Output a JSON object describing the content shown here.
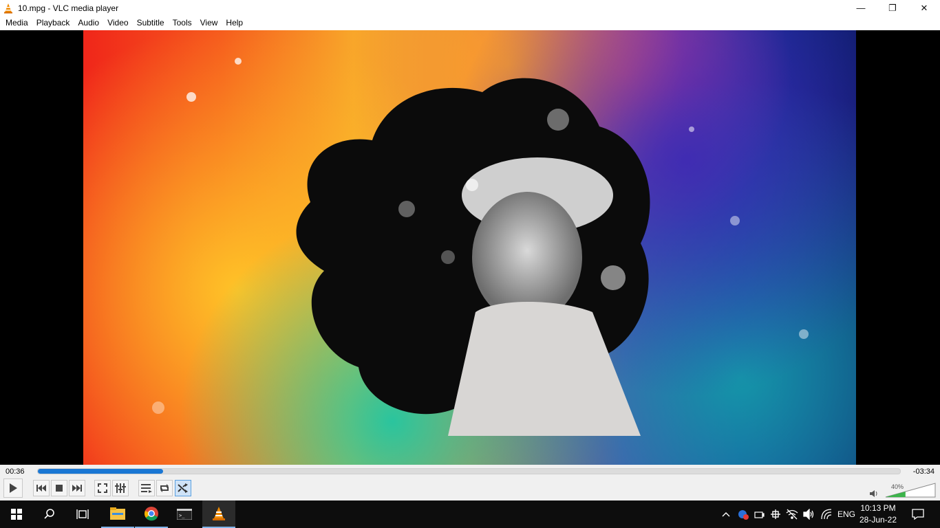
{
  "window": {
    "title": "10.mpg - VLC media player",
    "minimize_glyph": "—",
    "maximize_glyph": "❐",
    "close_glyph": "✕"
  },
  "menu": {
    "items": [
      "Media",
      "Playback",
      "Audio",
      "Video",
      "Subtitle",
      "Tools",
      "View",
      "Help"
    ]
  },
  "player": {
    "time_elapsed": "00:36",
    "time_remaining": "-03:34",
    "seek_progress": 0.145,
    "volume_label": "40%",
    "volume_level": 0.4,
    "random_active": true,
    "colors": {
      "accent": "#1a77d4",
      "volume_fill": "#3cb44b"
    }
  },
  "controls": [
    {
      "name": "play-button",
      "icon": "play-icon"
    },
    {
      "name": "previous-button",
      "icon": "skip-previous-icon"
    },
    {
      "name": "stop-button",
      "icon": "stop-icon"
    },
    {
      "name": "next-button",
      "icon": "skip-next-icon"
    },
    {
      "name": "fullscreen-button",
      "icon": "fullscreen-icon"
    },
    {
      "name": "extended-settings-button",
      "icon": "equalizer-icon"
    },
    {
      "name": "playlist-button",
      "icon": "playlist-icon"
    },
    {
      "name": "loop-button",
      "icon": "loop-icon"
    },
    {
      "name": "random-button",
      "icon": "shuffle-icon"
    }
  ],
  "taskbar": {
    "apps": [
      "start-icon",
      "search-icon",
      "task-view-icon",
      "file-explorer-icon",
      "chrome-icon",
      "terminal-icon",
      "vlc-icon"
    ],
    "tray": {
      "language": "ENG",
      "time": "10:13 PM",
      "date": "28-Jun-22"
    }
  }
}
